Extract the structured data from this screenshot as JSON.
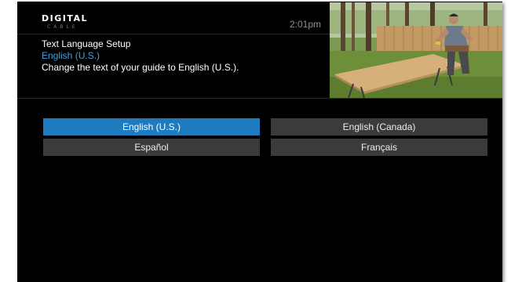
{
  "brand": {
    "logo_text": "DIGITAL",
    "logo_subtext": "CABLE"
  },
  "header": {
    "time": "2:01pm",
    "setting_title": "Text Language Setup",
    "selected_language": "English (U.S.)",
    "description": "Change the text of your guide to English (U.S.)."
  },
  "languages": [
    {
      "label": "English (U.S.)",
      "selected": true
    },
    {
      "label": "English (Canada)",
      "selected": false
    },
    {
      "label": "Español",
      "selected": false
    },
    {
      "label": "Français",
      "selected": false
    }
  ],
  "colors": {
    "background": "#000000",
    "accent": "#1f7bbf",
    "selected_text": "#4a9fd8",
    "button": "#3b3b3b"
  }
}
